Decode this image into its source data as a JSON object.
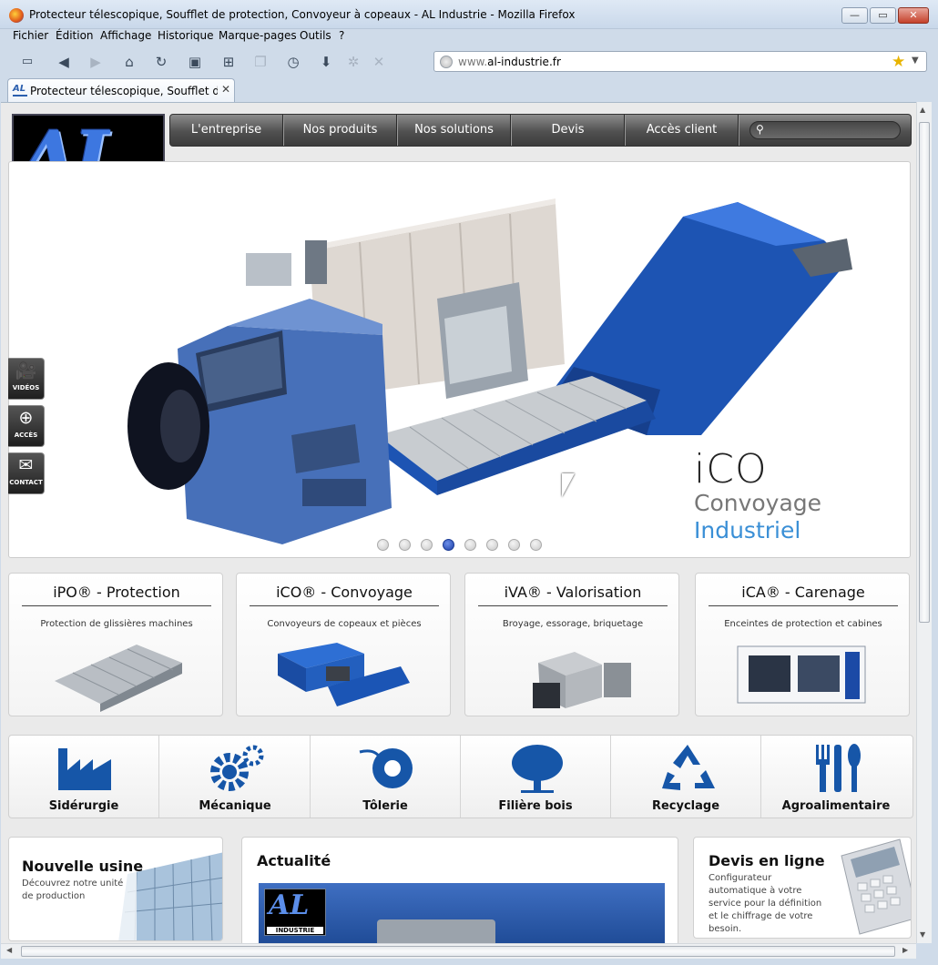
{
  "window": {
    "title": "Protecteur télescopique, Soufflet de protection, Convoyeur à copeaux - AL Industrie - Mozilla Firefox",
    "controls": {
      "minimize": "—",
      "maximize": "▭",
      "close": "✕"
    }
  },
  "menu": {
    "items": [
      "Fichier",
      "Édition",
      "Affichage",
      "Historique",
      "Marque-pages",
      "Outils",
      "?"
    ]
  },
  "toolbar": {
    "icons": [
      "webcam-icon",
      "back-icon",
      "forward-icon",
      "home-icon",
      "reload-icon",
      "window-icon",
      "add-icon",
      "copy-icon",
      "history-icon",
      "download-icon",
      "throbber-icon",
      "stop-icon"
    ]
  },
  "urlbar": {
    "prefix": "www.",
    "domain": "al-industrie.fr"
  },
  "tab": {
    "favicon": "AL",
    "title": "Protecteur télescopique, Soufflet de p...",
    "close": "✕"
  },
  "site": {
    "logo_letters": "AL",
    "logo_text": "INDUSTRIE",
    "nav": [
      "L'entreprise",
      "Nos produits",
      "Nos solutions",
      "Devis",
      "Accès client"
    ],
    "search": {
      "placeholder": ""
    },
    "slider": {
      "caption_line1": "iCO",
      "caption_line2": "Convoyage",
      "caption_line3": "Industriel",
      "dot_count": 8,
      "active_dot": 4
    },
    "side_tabs": [
      "VIDÉOS",
      "ACCÈS",
      "CONTACT"
    ],
    "products": [
      {
        "title": "iPO® - Protection",
        "subtitle": "Protection de glissières machines"
      },
      {
        "title": "iCO® - Convoyage",
        "subtitle": "Convoyeurs de copeaux et pièces"
      },
      {
        "title": "iVA® - Valorisation",
        "subtitle": "Broyage, essorage, briquetage"
      },
      {
        "title": "iCA® - Carenage",
        "subtitle": "Enceintes de protection et cabines"
      }
    ],
    "sectors": [
      "Sidérurgie",
      "Mécanique",
      "Tôlerie",
      "Filière bois",
      "Recyclage",
      "Agroalimentaire"
    ],
    "cards": {
      "usine": {
        "title": "Nouvelle usine",
        "text": "Découvrez notre unité de production"
      },
      "actu": {
        "title": "Actualité"
      },
      "devis": {
        "title": "Devis en ligne",
        "text": "Configurateur automatique à votre service pour la définition et le chiffrage de votre besoin."
      }
    }
  },
  "colors": {
    "accent": "#1b4fa8",
    "nav_bg": "#4a4a4a",
    "caption_blue": "#3a8fd6"
  }
}
